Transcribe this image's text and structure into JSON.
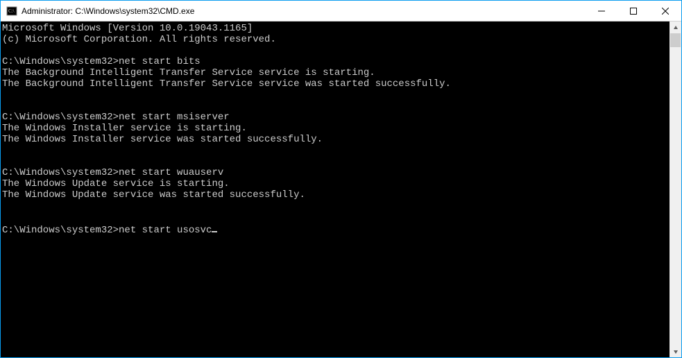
{
  "window": {
    "title": "Administrator: C:\\Windows\\system32\\CMD.exe"
  },
  "terminal": {
    "header1": "Microsoft Windows [Version 10.0.19043.1165]",
    "header2": "(c) Microsoft Corporation. All rights reserved.",
    "blocks": [
      {
        "prompt": "C:\\Windows\\system32>",
        "command": "net start bits",
        "out1": "The Background Intelligent Transfer Service service is starting.",
        "out2": "The Background Intelligent Transfer Service service was started successfully."
      },
      {
        "prompt": "C:\\Windows\\system32>",
        "command": "net start msiserver",
        "out1": "The Windows Installer service is starting.",
        "out2": "The Windows Installer service was started successfully."
      },
      {
        "prompt": "C:\\Windows\\system32>",
        "command": "net start wuauserv",
        "out1": "The Windows Update service is starting.",
        "out2": "The Windows Update service was started successfully."
      }
    ],
    "current_prompt": "C:\\Windows\\system32>",
    "current_command": "net start usosvc"
  }
}
